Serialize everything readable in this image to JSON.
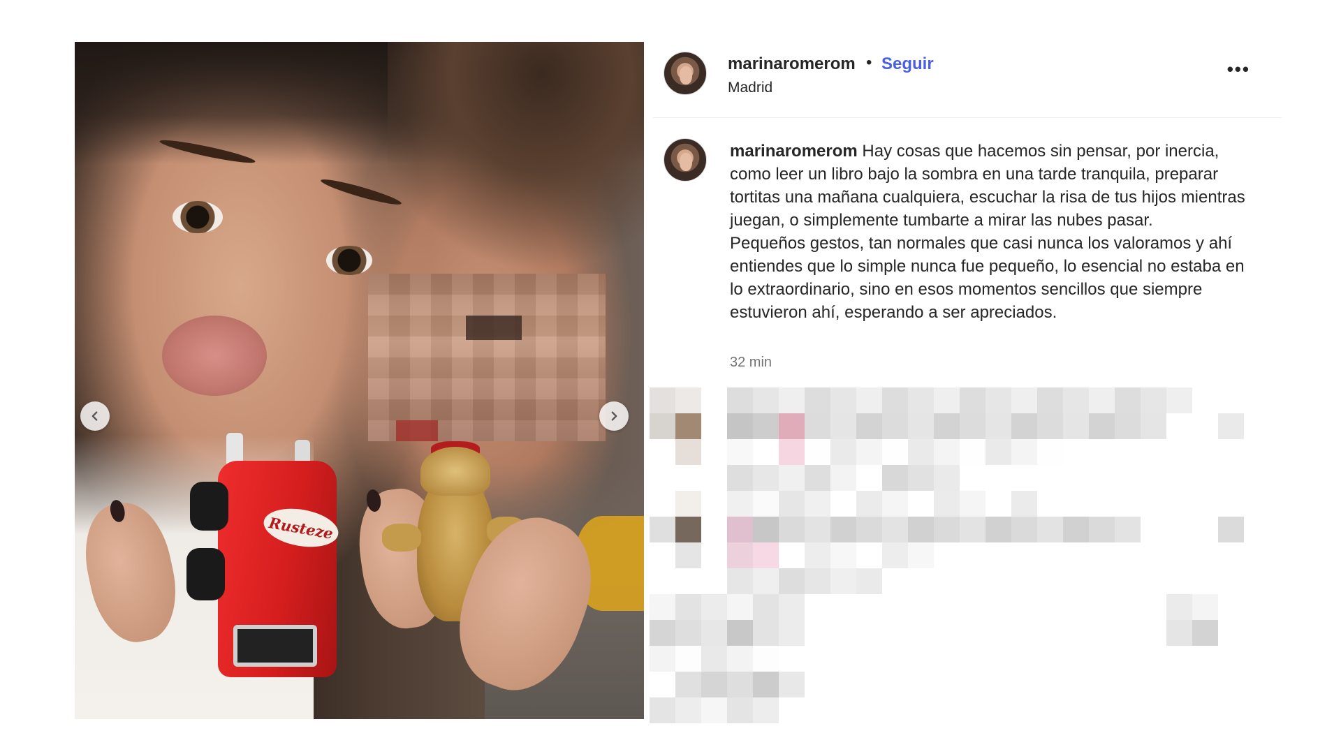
{
  "post": {
    "username": "marinaromerom",
    "separator": "•",
    "follow_label": "Seguir",
    "location": "Madrid",
    "more_label": "•••",
    "truck_logo_text": "Rusteze",
    "caption": {
      "username": "marinaromerom",
      "paragraph_1": "Hay cosas que hacemos sin pensar, por inercia, como leer un libro bajo la sombra en una tarde tranquila, preparar tortitas una mañana cualquiera, escuchar la risa de tus hijos mientras juegan, o simplemente tumbarte a mirar las nubes pasar.",
      "paragraph_2": "Pequeños gestos, tan normales que casi nunca los valoramos y ahí entiendes que lo simple nunca fue pequeño, lo esencial no estaba en lo extraordinario, sino en esos momentos sencillos que siempre estuvieron ahí, esperando a ser apreciados."
    },
    "timestamp": "32 min"
  },
  "carousel": {
    "prev_icon": "chevron-left-icon",
    "next_icon": "chevron-right-icon"
  },
  "colors": {
    "follow_blue": "#4a5fe6",
    "text": "#262626",
    "muted": "#737373"
  }
}
